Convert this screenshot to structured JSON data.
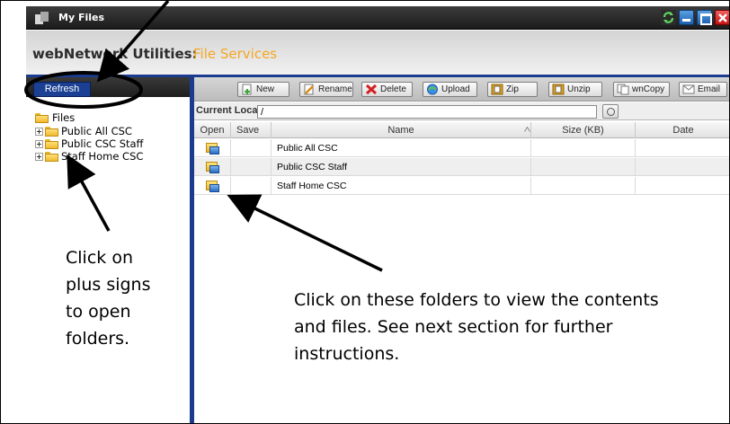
{
  "window": {
    "title": "My Files"
  },
  "header": {
    "app_label": "webNetwork Utilities:",
    "service_label": "File Services"
  },
  "left_panel": {
    "refresh_label": "Refresh",
    "tree": {
      "root": "Files",
      "items": [
        {
          "label": "Public All CSC"
        },
        {
          "label": "Public CSC Staff"
        },
        {
          "label": "Staff Home CSC"
        }
      ]
    }
  },
  "toolbar": {
    "buttons": [
      {
        "label": "New",
        "icon": "new-icon"
      },
      {
        "label": "Rename",
        "icon": "rename-icon"
      },
      {
        "label": "Delete",
        "icon": "delete-icon"
      },
      {
        "label": "Upload",
        "icon": "upload-icon"
      },
      {
        "label": "Zip",
        "icon": "zip-icon"
      },
      {
        "label": "Unzip",
        "icon": "unzip-icon"
      },
      {
        "label": "wnCopy",
        "icon": "copy-icon"
      },
      {
        "label": "Email",
        "icon": "email-icon"
      }
    ]
  },
  "location": {
    "label": "Current Location:",
    "value": "/"
  },
  "grid": {
    "columns": [
      "Open",
      "Save",
      "Name",
      "Size (KB)",
      "Date"
    ],
    "rows": [
      {
        "name": "Public All CSC",
        "size": "",
        "date": ""
      },
      {
        "name": "Public CSC Staff",
        "size": "",
        "date": ""
      },
      {
        "name": "Staff Home CSC",
        "size": "",
        "date": ""
      }
    ]
  },
  "annotations": {
    "left_note": "Click on plus signs to open folders.",
    "right_note": "Click on these folders to view the contents and files. See next section for further instructions."
  },
  "colors": {
    "accent_blue": "#1b3c8e",
    "service_orange": "#f5a623",
    "close_red": "#c41414"
  }
}
